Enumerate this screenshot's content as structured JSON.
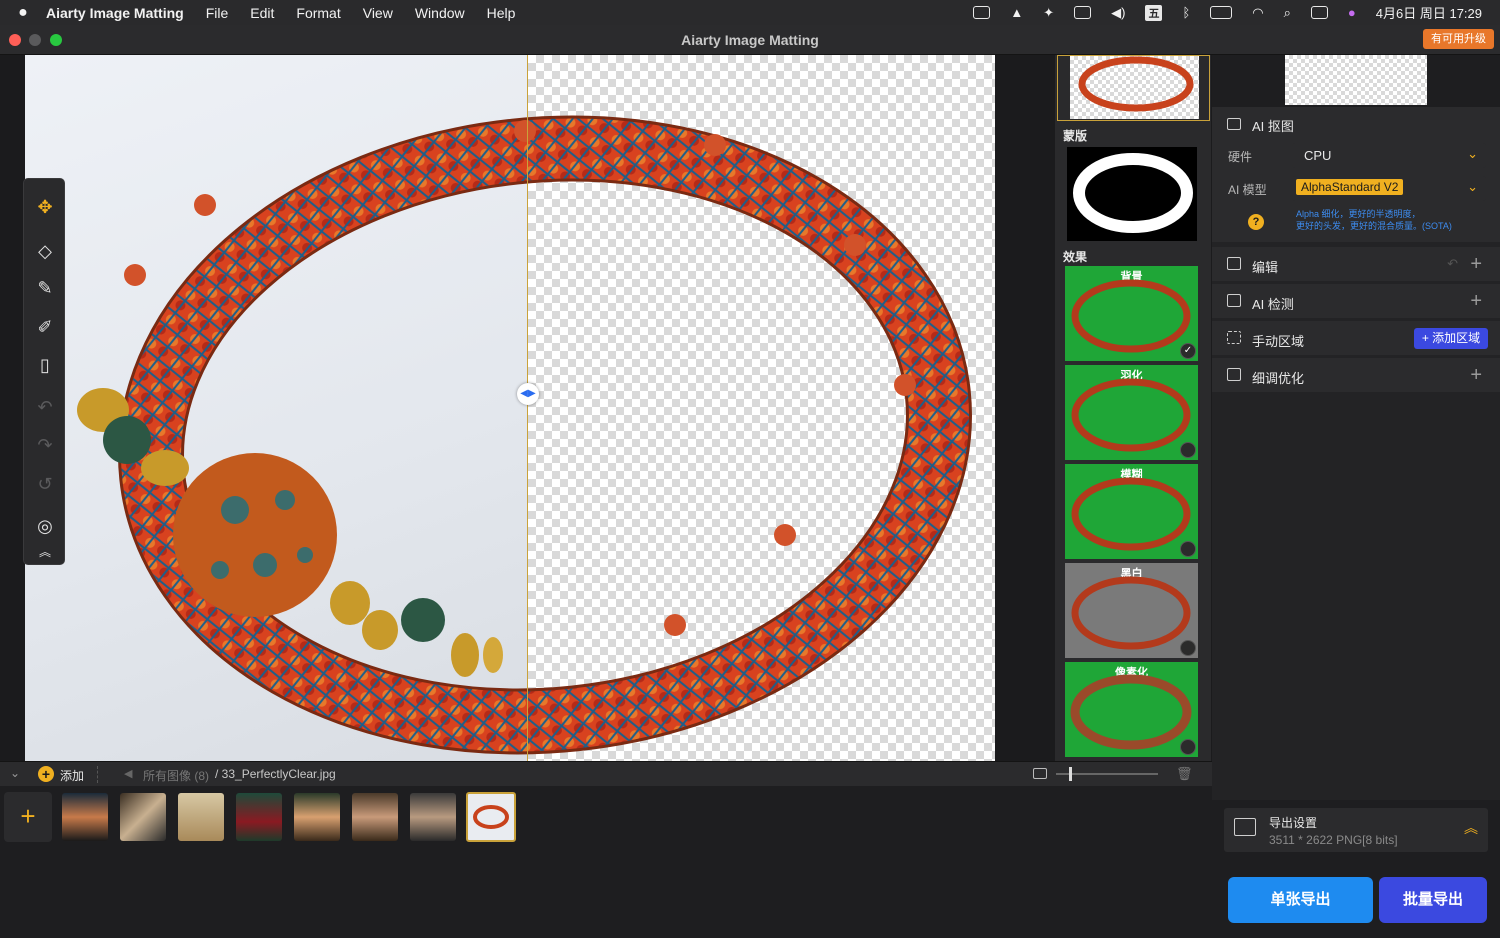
{
  "menubar": {
    "app_name": "Aiarty Image Matting",
    "items": [
      "File",
      "Edit",
      "Format",
      "View",
      "Window",
      "Help"
    ],
    "ime": "五",
    "datetime": "4月6日 周日 17:29"
  },
  "window": {
    "title": "Aiarty Image Matting",
    "upgrade_label": "有可用升级"
  },
  "layers": {
    "mask_label": "蒙版",
    "effects_label": "效果",
    "effects": [
      {
        "name": "背景",
        "selected": true
      },
      {
        "name": "羽化",
        "selected": false
      },
      {
        "name": "模糊",
        "selected": false
      },
      {
        "name": "黑白",
        "selected": false
      },
      {
        "name": "像素化",
        "selected": false
      }
    ]
  },
  "settings": {
    "ai_matting_label": "AI 抠图",
    "hardware_label": "硬件",
    "hardware_value": "CPU",
    "model_label": "AI 模型",
    "model_value": "AlphaStandard  V2",
    "model_desc_1": "Alpha 细化，更好的半透明度，",
    "model_desc_2": "更好的头发，更好的混合质量。(SOTA)",
    "edit_label": "编辑",
    "ai_detect_label": "AI 检测",
    "manual_region_label": "手动区域",
    "add_region_button": "添加区域",
    "fine_tune_label": "细调优化",
    "export_settings_label": "导出设置",
    "export_info": "3511 * 2622 PNG[8 bits]",
    "single_export": "单张导出",
    "batch_export": "批量导出"
  },
  "filmstrip": {
    "add_label": "添加",
    "breadcrumb_all": "所有图像 (8)",
    "breadcrumb_file": "/ 33_PerfectlyClear.jpg"
  },
  "colors": {
    "accent_yellow": "#f0b020",
    "effect_green": "#1fa637",
    "export_blue": "#1e8bf0",
    "batch_blue": "#3b49e0",
    "upgrade_orange": "#e8772a"
  }
}
